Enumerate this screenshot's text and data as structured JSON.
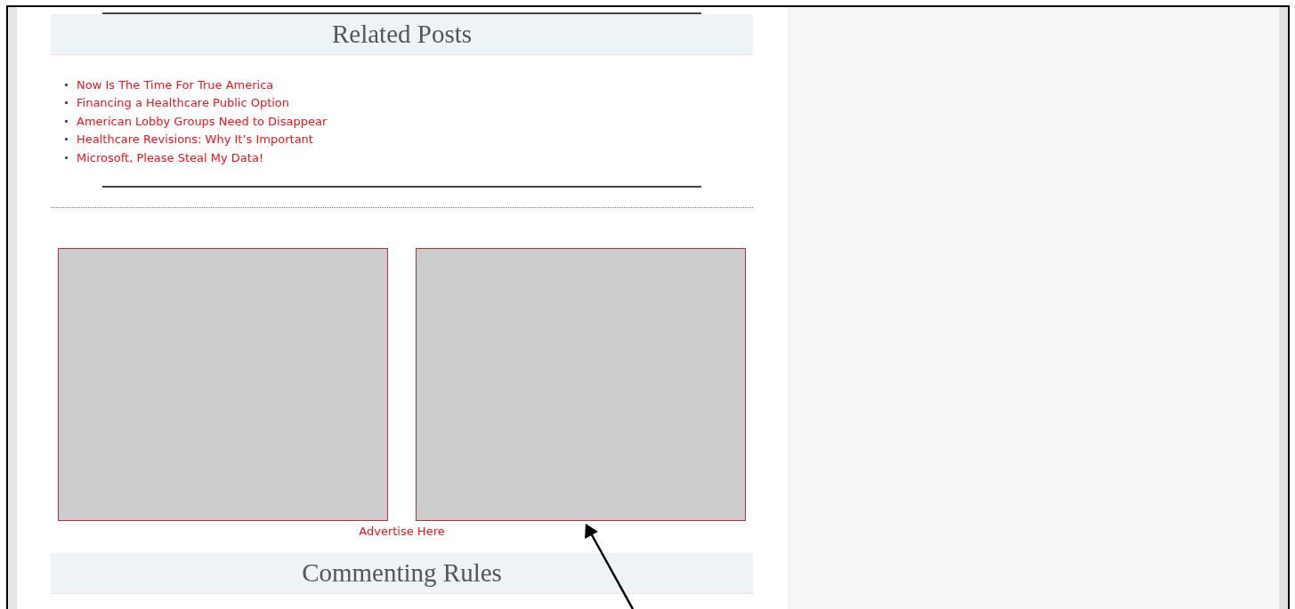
{
  "related_posts": {
    "title": "Related Posts",
    "items": [
      "Now Is The Time For True America",
      "Financing a Healthcare Public Option",
      "American Lobby Groups Need to Disappear",
      "Healthcare Revisions: Why It’s Important",
      "Microsoft, Please Steal My Data!"
    ]
  },
  "ad_slots": [
    {
      "kind": "placeholder"
    },
    {
      "kind": "placeholder"
    }
  ],
  "ad_link": "Advertise Here",
  "commenting_rules": {
    "title": "Commenting Rules"
  }
}
